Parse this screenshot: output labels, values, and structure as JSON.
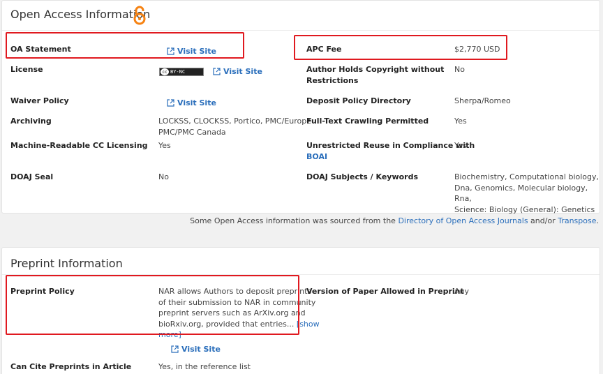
{
  "oa": {
    "title": "Open Access Information",
    "rows": {
      "oa_statement": {
        "label": "OA Statement",
        "link": "Visit Site"
      },
      "license": {
        "label": "License",
        "badge": "BY-NC",
        "link": "Visit Site"
      },
      "waiver": {
        "label": "Waiver Policy",
        "link": "Visit Site"
      },
      "archiving": {
        "label": "Archiving",
        "value_line1": "LOCKSS, CLOCKSS, Portico, PMC/Europe",
        "value_line2": "PMC/PMC Canada"
      },
      "machine_cc": {
        "label": "Machine-Readable CC Licensing",
        "value": "Yes"
      },
      "doaj_seal": {
        "label": "DOAJ Seal",
        "value": "No"
      },
      "apc_fee": {
        "label": "APC Fee",
        "value": "$2,770 USD"
      },
      "author_copyright": {
        "label_line1": "Author Holds Copyright without",
        "label_line2": "Restrictions",
        "value": "No"
      },
      "deposit_dir": {
        "label": "Deposit Policy Directory",
        "value": "Sherpa/Romeo"
      },
      "fulltext_crawl": {
        "label": "Full-Text Crawling Permitted",
        "value": "Yes"
      },
      "unrestricted_reuse": {
        "label_line1": "Unrestricted Reuse in Compliance with",
        "label_link": "BOAI",
        "value": "Yes"
      },
      "doaj_subjects": {
        "label": "DOAJ Subjects / Keywords",
        "value_line1": "Biochemistry, Computational biology,",
        "value_line2": "Dna, Genomics, Molecular biology, Rna,",
        "value_line3": "Science: Biology (General): Genetics"
      }
    },
    "source_note": {
      "prefix": "Some Open Access information was sourced from the ",
      "link1": "Directory of Open Access Journals",
      "middle": " and/or ",
      "link2": "Transpose",
      "suffix": "."
    }
  },
  "preprint": {
    "title": "Preprint Information",
    "rows": {
      "policy": {
        "label": "Preprint Policy",
        "line1": "NAR allows Authors to deposit preprints",
        "line2": "of their submission to NAR in community",
        "line3": "preprint servers such as ArXiv.org and",
        "line4_text": "bioRxiv.org, provided that entries... ",
        "line4_link": "[show",
        "line5_link": "more]",
        "link": "Visit Site"
      },
      "version": {
        "label": "Version of Paper Allowed in Preprint",
        "value": "Any"
      },
      "cite": {
        "label": "Can Cite Preprints in Article",
        "value": "Yes, in the reference list"
      }
    }
  },
  "colors": {
    "link": "#2a6ebb",
    "highlight": "#e0191f",
    "oa_orange": "#f68212"
  },
  "icons": {
    "open_access": "open-access-lock-icon",
    "external": "external-link-icon",
    "cc": "cc-license-icon"
  }
}
